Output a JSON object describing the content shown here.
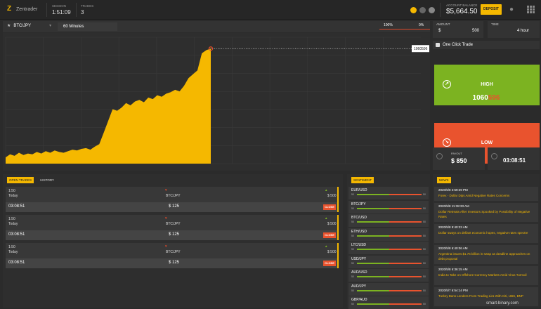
{
  "brand": {
    "name": "Zentrader"
  },
  "header": {
    "session_label": "SESSION",
    "session_value": "1:51:09",
    "trades_label": "TRADES",
    "trades_value": "3",
    "balance_label": "ACCOUNT BALANCE",
    "balance_value": "$5,664.50",
    "deposit_label": "DEPOSIT"
  },
  "toolbar": {
    "asset": "BTC/JPY",
    "timeframe": "60 Minutes",
    "pct_left": "100%",
    "pct_right": "0%"
  },
  "chart_data": {
    "type": "area",
    "title": "",
    "xlabel": "",
    "ylabel": "",
    "current_price_label": "1060596",
    "color": "#f5b800",
    "values": [
      8,
      12,
      10,
      14,
      11,
      13,
      12,
      15,
      13,
      16,
      14,
      17,
      15,
      14,
      16,
      18,
      17,
      19,
      20,
      18,
      22,
      25,
      40,
      55,
      70,
      68,
      72,
      78,
      75,
      80,
      82,
      79,
      85,
      83,
      88,
      86,
      90,
      92,
      95,
      93,
      100,
      110,
      115,
      120,
      142,
      146,
      148
    ]
  },
  "trade": {
    "amount_label": "AMOUNT",
    "amount_currency": "$",
    "amount_value": "500",
    "time_label": "TIME",
    "time_value": "4 hour",
    "one_click_label": "One Click Trade",
    "high_label": "HIGH",
    "low_label": "LOW",
    "price_main": "1060",
    "price_highlight": "596",
    "payout_label": "PAYOUT",
    "payout_value": "$ 850",
    "remaining_value": "03:08:51"
  },
  "open_trades": {
    "tab_open": "OPEN TRADES",
    "tab_history": "HISTORY",
    "rows": [
      {
        "time": "1:50",
        "day": "Today",
        "asset": "BTC/JPY",
        "stake": "$ 500",
        "expiry": "03:08:51",
        "amount": "$ 125",
        "close": "CLOSE"
      },
      {
        "time": "1:50",
        "day": "Today",
        "asset": "BTC/JPY",
        "stake": "$ 500",
        "expiry": "03:08:51",
        "amount": "$ 125",
        "close": "CLOSE"
      },
      {
        "time": "1:50",
        "day": "Today",
        "asset": "BTC/JPY",
        "stake": "$ 500",
        "expiry": "03:08:51",
        "amount": "$ 125",
        "close": "CLOSE"
      }
    ]
  },
  "sentiment": {
    "title": "SENTIMENT",
    "items": [
      {
        "pair": "EUR/USD",
        "left": "50",
        "right": "50",
        "pct": 0.5
      },
      {
        "pair": "BTC/JPY",
        "left": "50",
        "right": "50",
        "pct": 0.5
      },
      {
        "pair": "BTC/USD",
        "left": "50",
        "right": "50",
        "pct": 0.5
      },
      {
        "pair": "ETH/USD",
        "left": "50",
        "right": "50",
        "pct": 0.5
      },
      {
        "pair": "LTC/USD",
        "left": "50",
        "right": "50",
        "pct": 0.5
      },
      {
        "pair": "USD/JPY",
        "left": "50",
        "right": "50",
        "pct": 0.5
      },
      {
        "pair": "AUD/USD",
        "left": "50",
        "right": "50",
        "pct": 0.5
      },
      {
        "pair": "AUD/JPY",
        "left": "50",
        "right": "50",
        "pct": 0.5
      },
      {
        "pair": "GBP/AUD",
        "left": "50",
        "right": "50",
        "pct": 0.5
      }
    ]
  },
  "news": {
    "title": "NEWS",
    "items": [
      {
        "date": "2020/5/8 2:59:29 PM",
        "headline": "Forex - Dollar Dips Amid Negative Rates Concerns"
      },
      {
        "date": "2020/5/8 11:38:33 AM",
        "headline": "Dollar Retreats After Investors Spooked by Possibility of Negative Rates"
      },
      {
        "date": "2020/5/8 9:40:23 AM",
        "headline": "Dollar sways on defiant economic hopes, negative rates spectre"
      },
      {
        "date": "2020/5/8 6:40:06 AM",
        "headline": "Argentina issues $1.76 billion in swap as deadline approaches on debt proposal"
      },
      {
        "date": "2020/5/8 6:36:15 AM",
        "headline": "India to Take on Offshore Currency Markets Amid Virus Turmoil"
      },
      {
        "date": "2020/5/7 6:54:14 PM",
        "headline": "Turkey Bans Lenders From Trading Lira With Citi, UBS, BNP"
      }
    ]
  },
  "watermark": "smart-binary.com"
}
